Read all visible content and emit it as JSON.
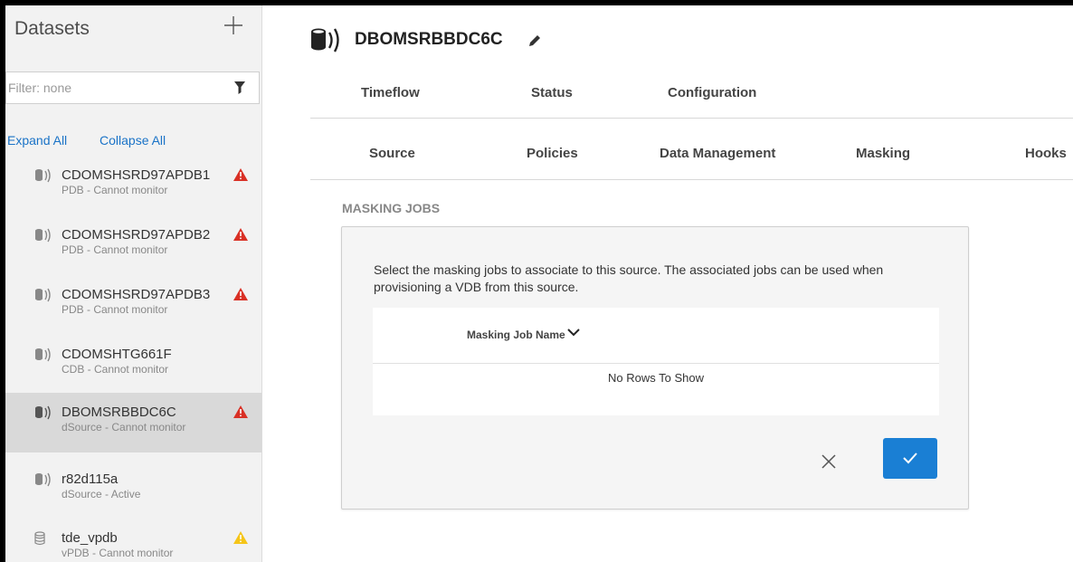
{
  "sidebar": {
    "title": "Datasets",
    "add_icon": "plus-icon",
    "filter": {
      "placeholder": "Filter: none",
      "icon": "filter-funnel-icon"
    },
    "expand_all": "Expand All",
    "collapse_all": "Collapse All",
    "items": [
      {
        "name": "CDOMSHSRD97APDB1",
        "subtitle": "PDB - Cannot monitor",
        "icon": "database-source-icon",
        "warning": "error-triangle-icon"
      },
      {
        "name": "CDOMSHSRD97APDB2",
        "subtitle": "PDB - Cannot monitor",
        "icon": "database-source-icon",
        "warning": "error-triangle-icon"
      },
      {
        "name": "CDOMSHSRD97APDB3",
        "subtitle": "PDB - Cannot monitor",
        "icon": "database-source-icon",
        "warning": "error-triangle-icon"
      },
      {
        "name": "CDOMSHTG661F",
        "subtitle": "CDB - Cannot monitor",
        "icon": "database-source-icon",
        "warning": ""
      },
      {
        "name": "DBOMSRBBDC6C",
        "subtitle": "dSource - Cannot monitor",
        "icon": "database-source-icon",
        "warning": "error-triangle-icon",
        "selected": true
      },
      {
        "name": "r82d115a",
        "subtitle": "dSource - Active",
        "icon": "database-source-icon",
        "warning": ""
      },
      {
        "name": "tde_vpdb",
        "subtitle": "vPDB - Cannot monitor",
        "icon": "database-virtual-icon",
        "warning": "caution-triangle-icon"
      }
    ]
  },
  "header": {
    "title": "DBOMSRBBDC6C",
    "icon": "database-source-icon",
    "edit_icon": "pencil-icon"
  },
  "tabs_primary": [
    "Timeflow",
    "Status",
    "Configuration"
  ],
  "tabs_secondary": [
    "Source",
    "Policies",
    "Data Management",
    "Masking",
    "Hooks"
  ],
  "masking": {
    "section_title": "MASKING JOBS",
    "description": "Select the masking jobs to associate to this source. The associated jobs can be used when provisioning a VDB from this source.",
    "column_header": "Masking Job Name",
    "empty_text": "No Rows To Show",
    "cancel_icon": "close-icon",
    "confirm_icon": "check-icon"
  },
  "colors": {
    "accent": "#1a7fd4",
    "link": "#1a73c7",
    "error": "#d93025",
    "warning": "#f5c518",
    "selected_row": "#d9d9d9"
  }
}
